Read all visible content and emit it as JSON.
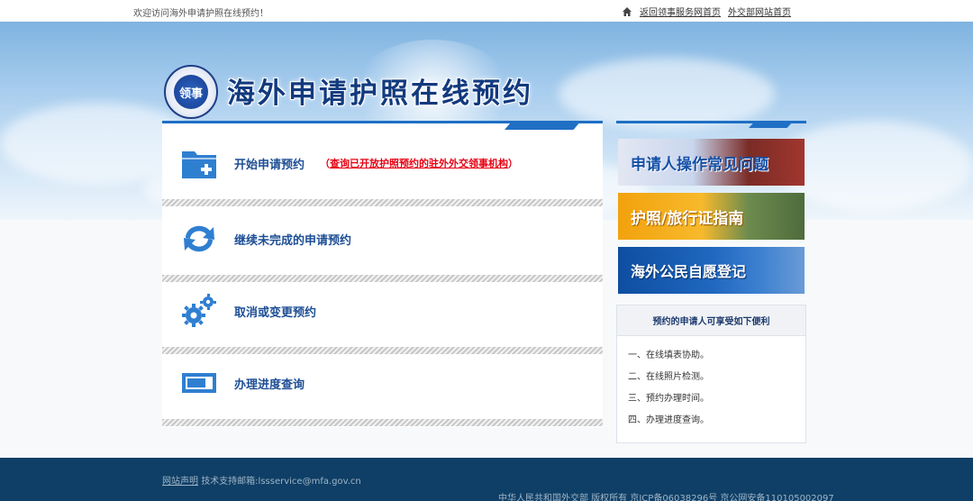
{
  "topbar": {
    "welcome": "欢迎访问海外申请护照在线预约！",
    "link_consular_home": "返回领事服务网首页",
    "link_mfa_home": "外交部网站首页"
  },
  "header": {
    "logo_text": "领事",
    "title": "海外申请护照在线预约"
  },
  "main": {
    "items": [
      {
        "label": "开始申请预约",
        "note_prefix": "（",
        "note_link": "查询已开放护照预约的驻外外交领事机构",
        "note_suffix": "）",
        "icon": "folder-add-icon"
      },
      {
        "label": "继续未完成的申请预约",
        "icon": "refresh-arrows-icon"
      },
      {
        "label": "取消或变更预约",
        "icon": "gears-icon"
      },
      {
        "label": "办理进度查询",
        "icon": "monitor-icon"
      }
    ]
  },
  "side": {
    "ads": [
      {
        "text": "申请人操作常见问题"
      },
      {
        "text": "护照/旅行证指南"
      },
      {
        "text": "海外公民自愿登记"
      }
    ],
    "benefit_title": "预约的申请人可享受如下便利",
    "benefits": [
      "一、在线填表协助。",
      "二、在线照片检测。",
      "三、预约办理时间。",
      "四、办理进度查询。"
    ]
  },
  "footer": {
    "site_statement": "网站声明",
    "support": "技术支持邮箱:lssservice@mfa.gov.cn",
    "copyright": "中华人民共和国外交部 版权所有 京ICP备06038296号 京公网安备110105002097"
  },
  "colors": {
    "accent": "#1f6fc4",
    "title": "#123a7e",
    "footer_bg": "#0f3f66",
    "warning": "#e60012"
  }
}
